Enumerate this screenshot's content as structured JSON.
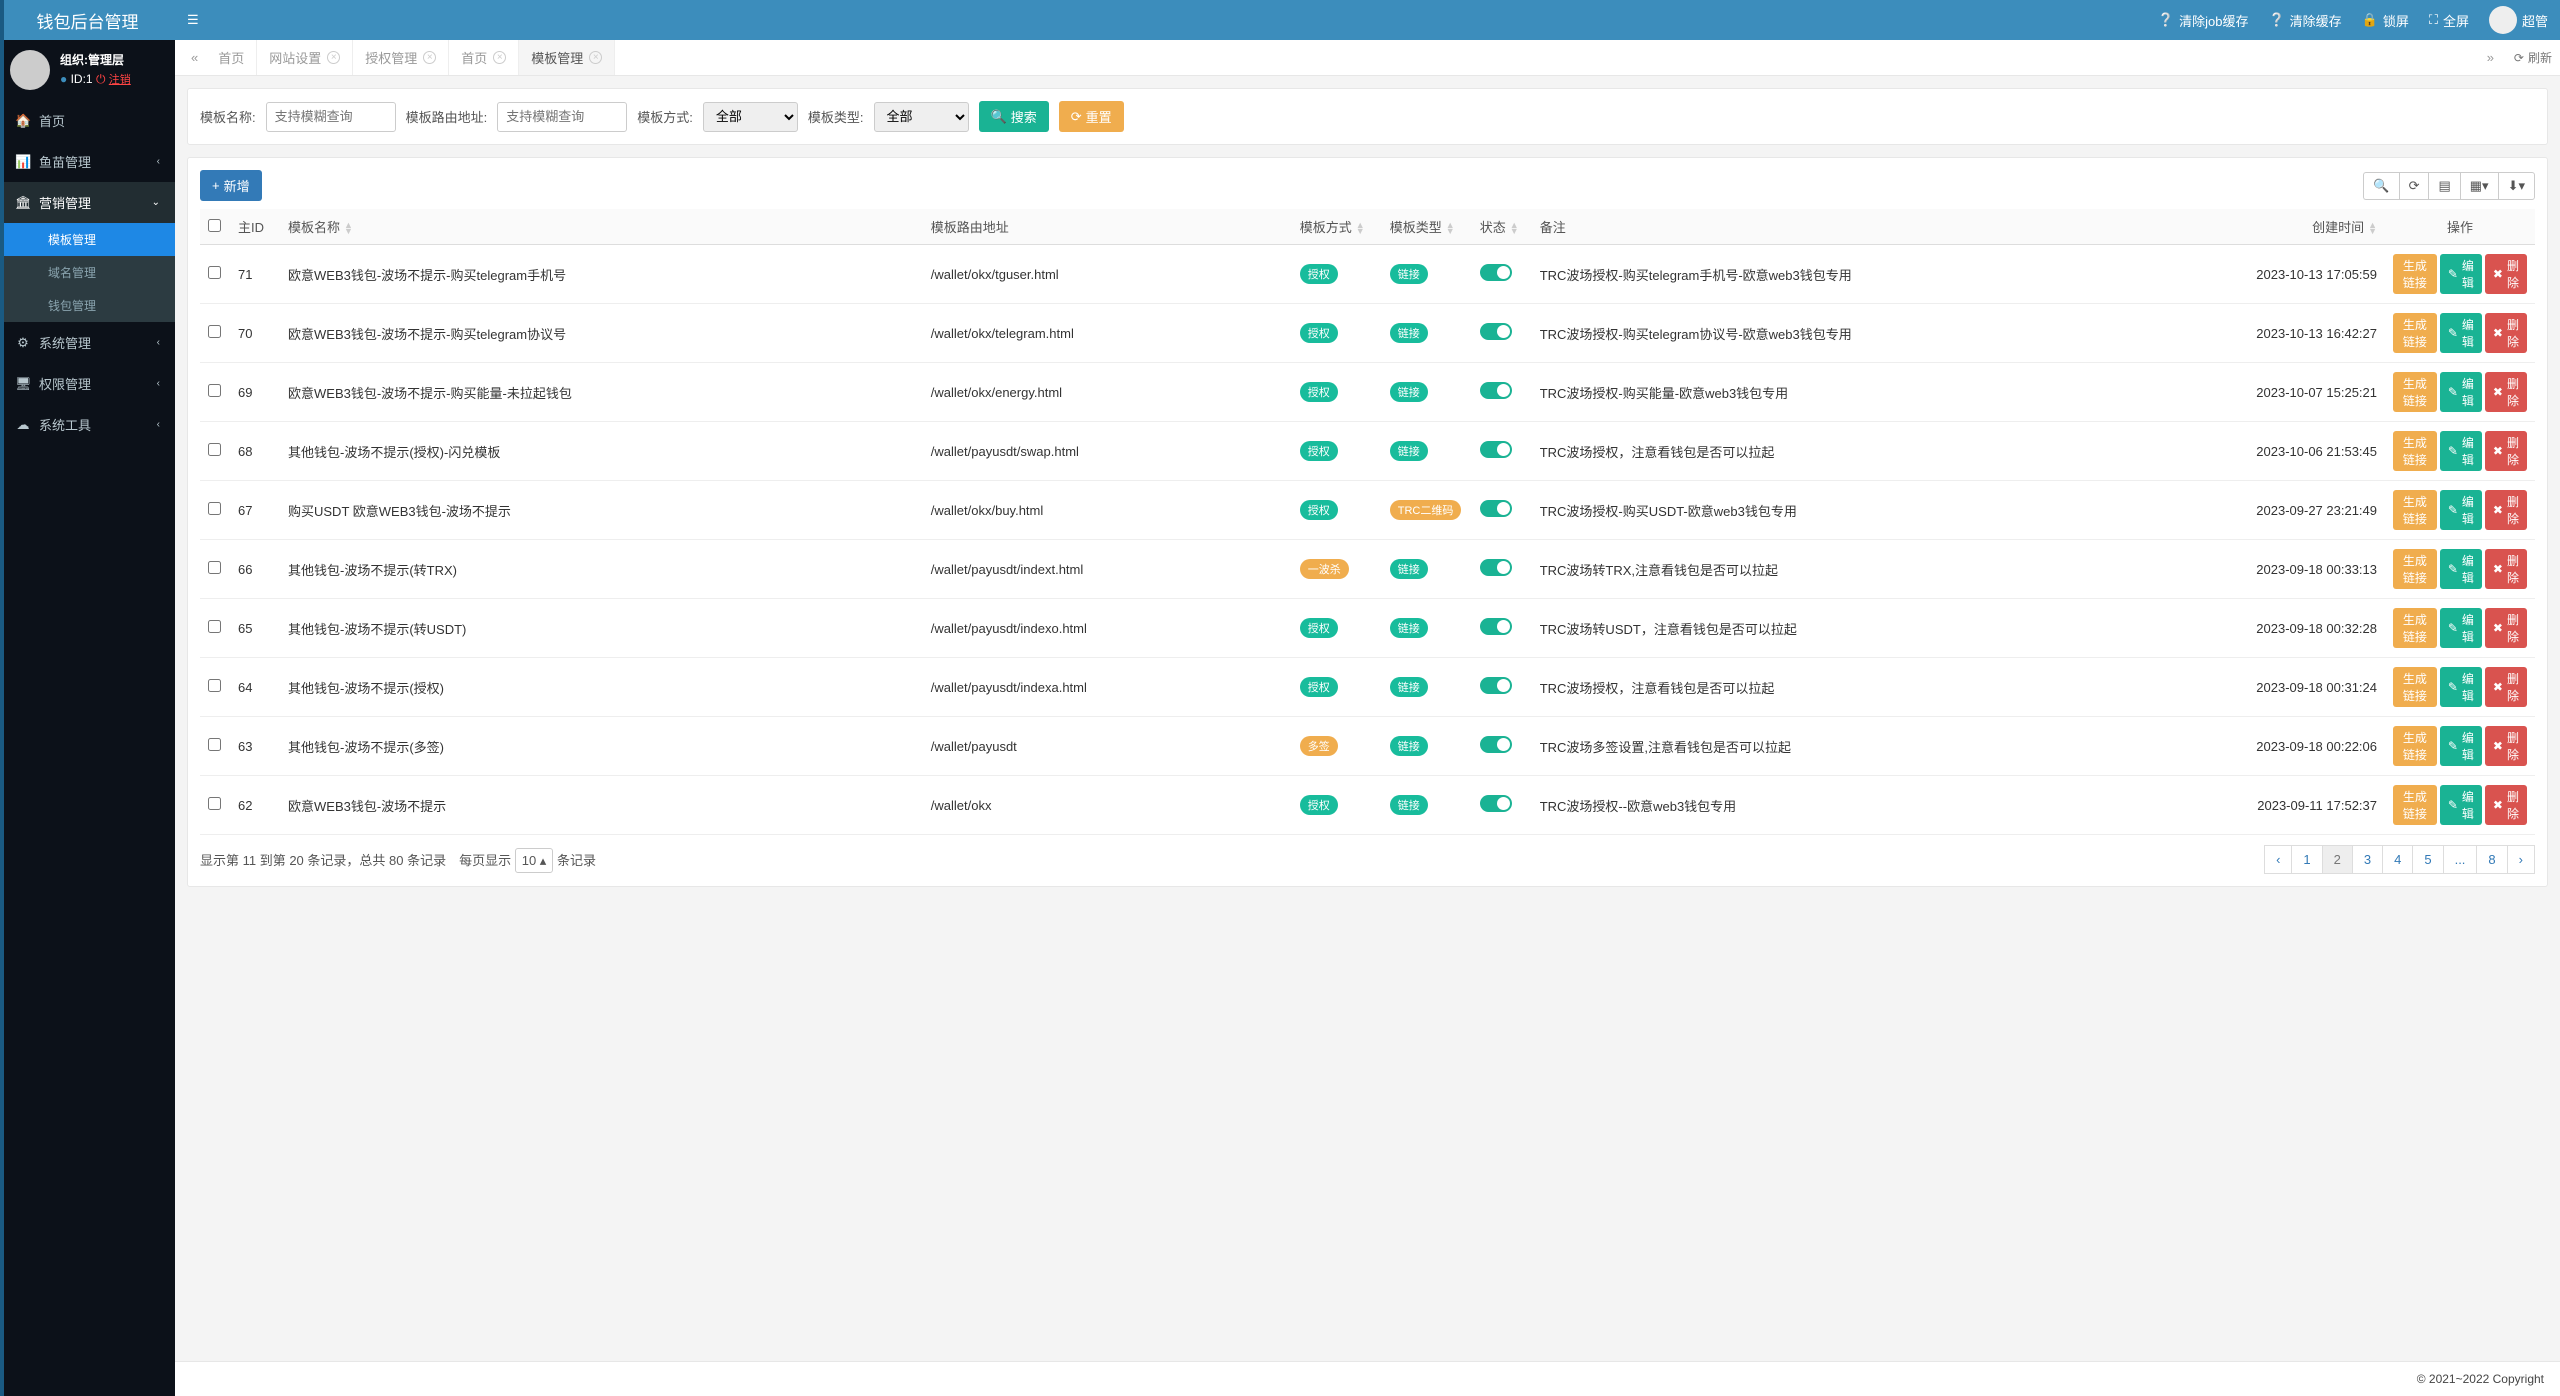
{
  "logo": "钱包后台管理",
  "profile": {
    "org": "组织:管理层",
    "id_label": "ID:1",
    "logout": "注销"
  },
  "menu": [
    {
      "icon": "🏠",
      "label": "首页",
      "expand": false,
      "chev": ""
    },
    {
      "icon": "📊",
      "label": "鱼苗管理",
      "expand": false,
      "chev": "‹"
    },
    {
      "icon": "🏛",
      "label": "营销管理",
      "expand": true,
      "chev": "⌄",
      "children": [
        {
          "label": "模板管理",
          "active": true
        },
        {
          "label": "域名管理",
          "active": false
        },
        {
          "label": "钱包管理",
          "active": false
        }
      ]
    },
    {
      "icon": "⚙",
      "label": "系统管理",
      "expand": false,
      "chev": "‹"
    },
    {
      "icon": "🖥",
      "label": "权限管理",
      "expand": false,
      "chev": "‹"
    },
    {
      "icon": "☁",
      "label": "系统工具",
      "expand": false,
      "chev": "‹"
    }
  ],
  "topbar": {
    "clear_job": "清除job缓存",
    "clear_cache": "清除缓存",
    "lock": "锁屏",
    "fullscreen": "全屏",
    "user": "超管"
  },
  "tabs": {
    "items": [
      {
        "label": "首页",
        "closable": false
      },
      {
        "label": "网站设置",
        "closable": true
      },
      {
        "label": "授权管理",
        "closable": true
      },
      {
        "label": "首页",
        "closable": true
      },
      {
        "label": "模板管理",
        "closable": true,
        "active": true
      }
    ],
    "refresh": "刷新"
  },
  "search": {
    "name_label": "模板名称:",
    "name_placeholder": "支持模糊查询",
    "route_label": "模板路由地址:",
    "route_placeholder": "支持模糊查询",
    "method_label": "模板方式:",
    "method_value": "全部",
    "type_label": "模板类型:",
    "type_value": "全部",
    "search_btn": "搜索",
    "reset_btn": "重置"
  },
  "toolbar": {
    "add": "新增"
  },
  "table": {
    "headers": {
      "id": "主ID",
      "name": "模板名称",
      "route": "模板路由地址",
      "method": "模板方式",
      "type": "模板类型",
      "status": "状态",
      "remark": "备注",
      "created": "创建时间",
      "ops": "操作"
    },
    "rows": [
      {
        "id": "71",
        "name": "欧意WEB3钱包-波场不提示-购买telegram手机号",
        "route": "/wallet/okx/tguser.html",
        "method": "授权",
        "method_cls": "tag-teal",
        "type": "链接",
        "type_cls": "tag-teal",
        "remark": "TRC波场授权-购买telegram手机号-欧意web3钱包专用",
        "created": "2023-10-13 17:05:59"
      },
      {
        "id": "70",
        "name": "欧意WEB3钱包-波场不提示-购买telegram协议号",
        "route": "/wallet/okx/telegram.html",
        "method": "授权",
        "method_cls": "tag-teal",
        "type": "链接",
        "type_cls": "tag-teal",
        "remark": "TRC波场授权-购买telegram协议号-欧意web3钱包专用",
        "created": "2023-10-13 16:42:27"
      },
      {
        "id": "69",
        "name": "欧意WEB3钱包-波场不提示-购买能量-未拉起钱包",
        "route": "/wallet/okx/energy.html",
        "method": "授权",
        "method_cls": "tag-teal",
        "type": "链接",
        "type_cls": "tag-teal",
        "remark": "TRC波场授权-购买能量-欧意web3钱包专用",
        "created": "2023-10-07 15:25:21"
      },
      {
        "id": "68",
        "name": "其他钱包-波场不提示(授权)-闪兑模板",
        "route": "/wallet/payusdt/swap.html",
        "method": "授权",
        "method_cls": "tag-teal",
        "type": "链接",
        "type_cls": "tag-teal",
        "remark": "TRC波场授权，注意看钱包是否可以拉起",
        "created": "2023-10-06 21:53:45"
      },
      {
        "id": "67",
        "name": "购买USDT 欧意WEB3钱包-波场不提示",
        "route": "/wallet/okx/buy.html",
        "method": "授权",
        "method_cls": "tag-teal",
        "type": "TRC二维码",
        "type_cls": "tag-orange",
        "remark": "TRC波场授权-购买USDT-欧意web3钱包专用",
        "created": "2023-09-27 23:21:49"
      },
      {
        "id": "66",
        "name": "其他钱包-波场不提示(转TRX)",
        "route": "/wallet/payusdt/indext.html",
        "method": "一波杀",
        "method_cls": "tag-orange",
        "type": "链接",
        "type_cls": "tag-teal",
        "remark": "TRC波场转TRX,注意看钱包是否可以拉起",
        "created": "2023-09-18 00:33:13"
      },
      {
        "id": "65",
        "name": "其他钱包-波场不提示(转USDT)",
        "route": "/wallet/payusdt/indexo.html",
        "method": "授权",
        "method_cls": "tag-teal",
        "type": "链接",
        "type_cls": "tag-teal",
        "remark": "TRC波场转USDT，注意看钱包是否可以拉起",
        "created": "2023-09-18 00:32:28"
      },
      {
        "id": "64",
        "name": "其他钱包-波场不提示(授权)",
        "route": "/wallet/payusdt/indexa.html",
        "method": "授权",
        "method_cls": "tag-teal",
        "type": "链接",
        "type_cls": "tag-teal",
        "remark": "TRC波场授权，注意看钱包是否可以拉起",
        "created": "2023-09-18 00:31:24"
      },
      {
        "id": "63",
        "name": "其他钱包-波场不提示(多签)",
        "route": "/wallet/payusdt",
        "method": "多签",
        "method_cls": "tag-orange",
        "type": "链接",
        "type_cls": "tag-teal",
        "remark": "TRC波场多签设置,注意看钱包是否可以拉起",
        "created": "2023-09-18 00:22:06"
      },
      {
        "id": "62",
        "name": "欧意WEB3钱包-波场不提示",
        "route": "/wallet/okx",
        "method": "授权",
        "method_cls": "tag-teal",
        "type": "链接",
        "type_cls": "tag-teal",
        "remark": "TRC波场授权--欧意web3钱包专用",
        "created": "2023-09-11 17:52:37"
      }
    ],
    "ops": {
      "gen": "生成链接",
      "edit": "编辑",
      "del": "删除"
    }
  },
  "pager": {
    "info_pre": "显示第 11 到第 20 条记录，总共 80 条记录　每页显示",
    "info_post": "条记录",
    "page_size": "10",
    "pages": [
      "‹",
      "1",
      "2",
      "3",
      "4",
      "5",
      "...",
      "8",
      "›"
    ],
    "active_index": 2
  },
  "footer": "© 2021~2022 Copyright"
}
